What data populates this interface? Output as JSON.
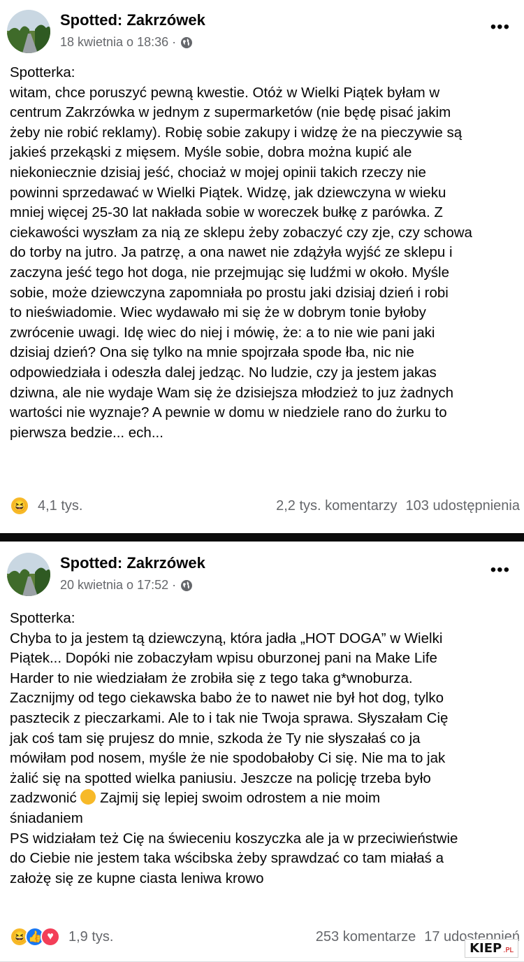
{
  "posts": [
    {
      "page_name": "Spotted: Zakrzówek",
      "timestamp": "18 kwietnia o 18:36 ·",
      "body_lines": [
        "Spotterka:",
        "witam, chce poruszyć pewną kwestie. Otóż w Wielki Piątek byłam w",
        "centrum Zakrzówka w jednym z supermarketów (nie będę pisać jakim",
        "żeby nie robić reklamy). Robię sobie zakupy i widzę że na pieczywie są",
        "jakieś przekąski z mięsem. Myśle sobie, dobra można kupić ale",
        "niekoniecznie dzisiaj jeść, chociaż w mojej opinii takich rzeczy nie",
        "powinni sprzedawać w Wielki Piątek. Widzę, jak dziewczyna w wieku",
        "mniej więcej 25-30 lat nakłada sobie w woreczek bułkę z parówka. Z",
        "ciekawości wyszłam za nią ze sklepu żeby zobaczyć czy zje, czy schowa",
        "do torby na jutro. Ja patrzę, a ona nawet nie zdążyła wyjść ze sklepu i",
        "zaczyna jeść tego hot doga, nie przejmując się ludźmi w około. Myśle",
        "sobie, może dziewczyna zapomniała po prostu jaki dzisiaj dzień i robi",
        "to nieświadomie. Wiec wydawało mi się że w dobrym tonie byłoby",
        "zwrócenie uwagi. Idę wiec do niej i mówię, że: a to nie wie pani jaki",
        "dzisiaj dzień? Ona się tylko na mnie spojrzała spode łba, nic nie",
        "odpowiedziała i odeszła dalej jedząc. No ludzie, czy ja jestem jakas",
        "dziwna, ale nie wydaje Wam się że dzisiejsza młodzież to juz żadnych",
        "wartości nie wyznaje? A pewnie w domu w niedziele rano do żurku to",
        "pierwsza bedzie... ech..."
      ],
      "reaction_count": "4,1 tys.",
      "comments": "2,2 tys. komentarzy",
      "shares": "103 udostępnienia"
    },
    {
      "page_name": "Spotted: Zakrzówek",
      "timestamp": "20 kwietnia o 17:52 ·",
      "body_lines": [
        "Spotterka:",
        "Chyba to ja jestem tą dziewczyną, która jadła „HOT DOGA” w Wielki",
        "Piątek... Dopóki nie zobaczyłam wpisu oburzonej pani na Make Life",
        "Harder to nie wiedziałam że zrobiła się z tego taka g*wnoburza.",
        "Zacznijmy od tego ciekawska babo że to nawet nie był hot dog, tylko",
        "pasztecik z pieczarkami. Ale to i tak nie Twoja sprawa. Słyszałam Cię",
        "jak coś tam się prujesz do mnie, szkoda że Ty nie słyszałaś co ja",
        "mówiłam pod nosem, myśle że nie spodobałoby Ci się. Nie ma to jak",
        "żalić się na spotted wielka paniusiu. Jeszcze na policję trzeba było",
        "zadzwonić",
        "Zajmij się lepiej swoim odrostem a nie moim",
        "śniadaniem",
        "PS widziałam też Cię na świeceniu koszyczka ale ja w przeciwieństwie",
        "do Ciebie nie jestem taka wścibska żeby sprawdzać co tam miałaś a",
        "założę się ze kupne ciasta leniwa krowo"
      ],
      "reaction_count": "1,9 tys.",
      "comments": "253 komentarze",
      "shares": "17 udostępnień"
    }
  ],
  "icons": {
    "more": "more-options-icon",
    "globe": "globe-icon",
    "haha": "haha-reaction-icon",
    "like": "like-reaction-icon",
    "love": "love-reaction-icon"
  },
  "watermark": {
    "main": "KIEP",
    "suffix": ".PL"
  },
  "colors": {
    "meta_gray": "#65676b",
    "like_blue": "#1877f2",
    "love_red": "#f33e58",
    "haha_yellow": "#f7b928"
  }
}
